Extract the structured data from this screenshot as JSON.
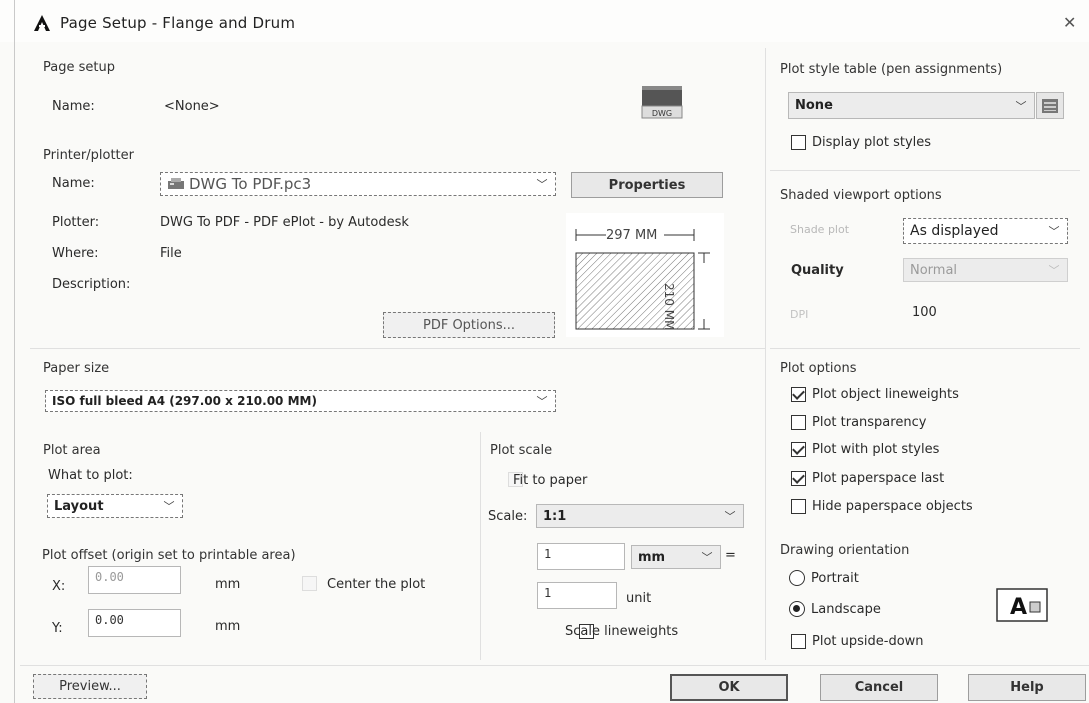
{
  "window": {
    "title": "Page Setup - Flange and Drum",
    "logo_icon": "autocad-a-icon",
    "close_icon": "close-icon"
  },
  "page_setup": {
    "header": "Page setup",
    "name_label": "Name:",
    "name_value": "<None>",
    "dwg_icon": "dwg-icon"
  },
  "printer": {
    "header": "Printer/plotter",
    "name_label": "Name:",
    "name_value": "DWG To PDF.pc3",
    "properties_label": "Properties",
    "plotter_label": "Plotter:",
    "plotter_value": "DWG To PDF - PDF ePlot - by Autodesk",
    "where_label": "Where:",
    "where_value": "File",
    "description_label": "Description:",
    "pdf_options_label": "PDF Options...",
    "preview": {
      "width": "297",
      "height": "210",
      "unit": "MM"
    }
  },
  "paper_size": {
    "header": "Paper size",
    "value": "ISO full bleed A4 (297.00 x 210.00 MM)"
  },
  "plot_area": {
    "header": "Plot area",
    "what_label": "What to plot:",
    "what_value": "Layout"
  },
  "plot_offset": {
    "header": "Plot offset (origin set to printable area)",
    "x_label": "X:",
    "x_value": "0.00",
    "y_label": "Y:",
    "y_value": "0.00",
    "unit": "mm",
    "center_label": "Center the plot"
  },
  "plot_scale": {
    "header": "Plot scale",
    "fit_label": "Fit to paper",
    "scale_label": "Scale:",
    "scale_value": "1:1",
    "num_value": "1",
    "num_unit": "mm",
    "equals": "=",
    "den_value": "1",
    "den_unit": "unit",
    "lineweights_label": "Scale lineweights"
  },
  "plot_style": {
    "header": "Plot style table (pen assignments)",
    "value": "None",
    "edit_icon": "edit-table-icon",
    "display_label": "Display plot styles"
  },
  "shaded": {
    "header": "Shaded viewport options",
    "shade_label": "Shade plot",
    "shade_value": "As displayed",
    "quality_label": "Quality",
    "quality_value": "Normal",
    "dpi_label": "DPI",
    "dpi_value": "100"
  },
  "plot_options": {
    "header": "Plot options",
    "items": [
      {
        "label": "Plot object lineweights",
        "checked": true
      },
      {
        "label": "Plot transparency",
        "checked": false
      },
      {
        "label": "Plot with plot styles",
        "checked": true
      },
      {
        "label": "Plot paperspace last",
        "checked": true
      },
      {
        "label": "Hide paperspace objects",
        "checked": false
      }
    ]
  },
  "orientation": {
    "header": "Drawing orientation",
    "portrait_label": "Portrait",
    "landscape_label": "Landscape",
    "upside_label": "Plot upside-down",
    "selected": "Landscape",
    "icon": "landscape-a-icon"
  },
  "footer": {
    "preview_label": "Preview...",
    "ok_label": "OK",
    "cancel_label": "Cancel",
    "help_label": "Help"
  }
}
